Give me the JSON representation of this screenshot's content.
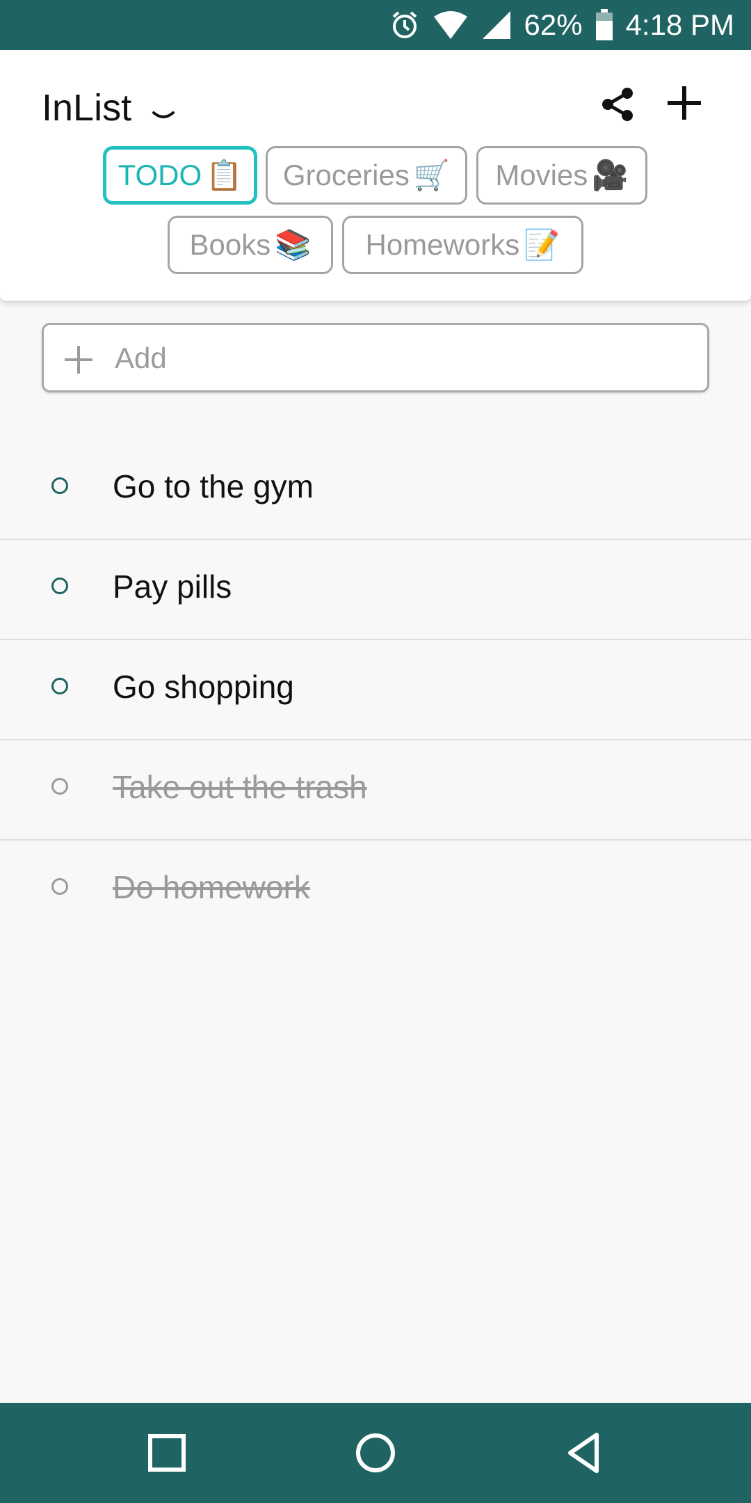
{
  "status_bar": {
    "battery": "62%",
    "time": "4:18 PM",
    "icons": [
      "alarm-icon",
      "wifi-icon",
      "signal-icon",
      "battery-icon"
    ]
  },
  "header": {
    "title": "InList",
    "icons": [
      "chevron-down-icon",
      "share-icon",
      "plus-icon"
    ]
  },
  "tabs": [
    {
      "label": "TODO",
      "emoji": "📋",
      "active": true
    },
    {
      "label": "Groceries",
      "emoji": "🛒",
      "active": false
    },
    {
      "label": "Movies",
      "emoji": "🎥",
      "active": false
    },
    {
      "label": "Books",
      "emoji": "📚",
      "active": false
    },
    {
      "label": "Homeworks",
      "emoji": "📝",
      "active": false
    }
  ],
  "add_input": {
    "placeholder": "Add"
  },
  "items": [
    {
      "text": "Go to the gym",
      "done": false
    },
    {
      "text": "Pay pills",
      "done": false
    },
    {
      "text": "Go shopping",
      "done": false
    },
    {
      "text": "Take out the trash",
      "done": true
    },
    {
      "text": "Do homework",
      "done": true
    }
  ],
  "nav": {
    "icons": [
      "recents-square-icon",
      "home-circle-icon",
      "back-triangle-icon"
    ]
  },
  "colors": {
    "primary": "#1f6462",
    "accent": "#22c1c0",
    "background": "#f8f8f8"
  }
}
